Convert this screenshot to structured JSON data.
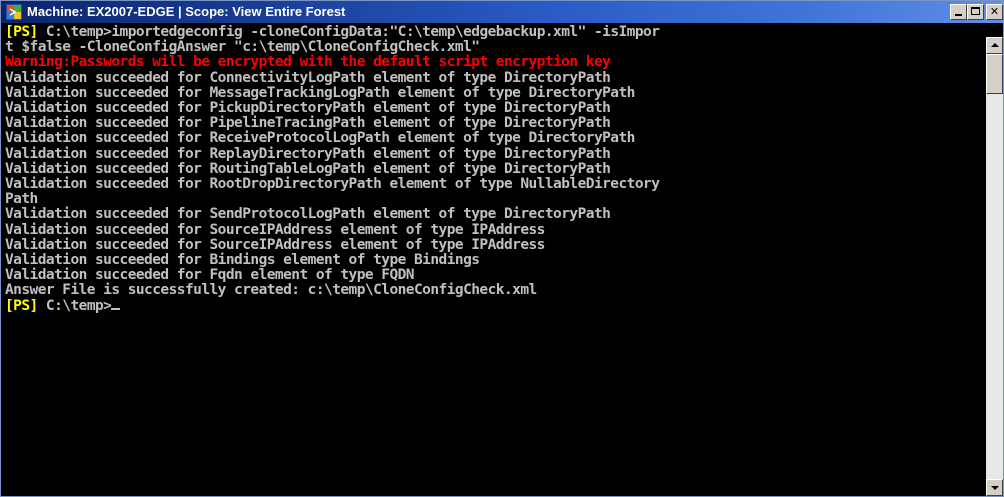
{
  "window": {
    "title": "Machine: EX2007-EDGE | Scope: View Entire Forest",
    "colors": {
      "background": "#000000",
      "text": "#c0c0c0",
      "prompt": "#ffff00",
      "warning": "#ff0000"
    }
  },
  "console": {
    "cmd1": {
      "prompt": "[PS]",
      "text": " C:\\temp>importedgeconfig -cloneConfigData:\"C:\\temp\\edgebackup.xml\" -isImpor"
    },
    "cmd1_cont": "t $false -CloneConfigAnswer \"c:\\temp\\CloneConfigCheck.xml\"",
    "warning": "Warning:Passwords will be encrypted with the default script encryption key",
    "lines": [
      "Validation succeeded for ConnectivityLogPath element of type DirectoryPath",
      "Validation succeeded for MessageTrackingLogPath element of type DirectoryPath",
      "Validation succeeded for PickupDirectoryPath element of type DirectoryPath",
      "Validation succeeded for PipelineTracingPath element of type DirectoryPath",
      "Validation succeeded for ReceiveProtocolLogPath element of type DirectoryPath",
      "Validation succeeded for ReplayDirectoryPath element of type DirectoryPath",
      "Validation succeeded for RoutingTableLogPath element of type DirectoryPath",
      "Validation succeeded for RootDropDirectoryPath element of type NullableDirectory",
      "Path",
      "Validation succeeded for SendProtocolLogPath element of type DirectoryPath",
      "Validation succeeded for SourceIPAddress element of type IPAddress",
      "Validation succeeded for SourceIPAddress element of type IPAddress",
      "Validation succeeded for Bindings element of type Bindings",
      "Validation succeeded for Fqdn element of type FQDN",
      "Answer File is successfully created: c:\\temp\\CloneConfigCheck.xml"
    ],
    "cmd2": {
      "prompt": "[PS]",
      "text": " C:\\temp>"
    }
  },
  "icons": {
    "app": "powershell-icon",
    "minimize": "minimize-icon",
    "maximize": "maximize-icon",
    "close": "close-icon"
  }
}
